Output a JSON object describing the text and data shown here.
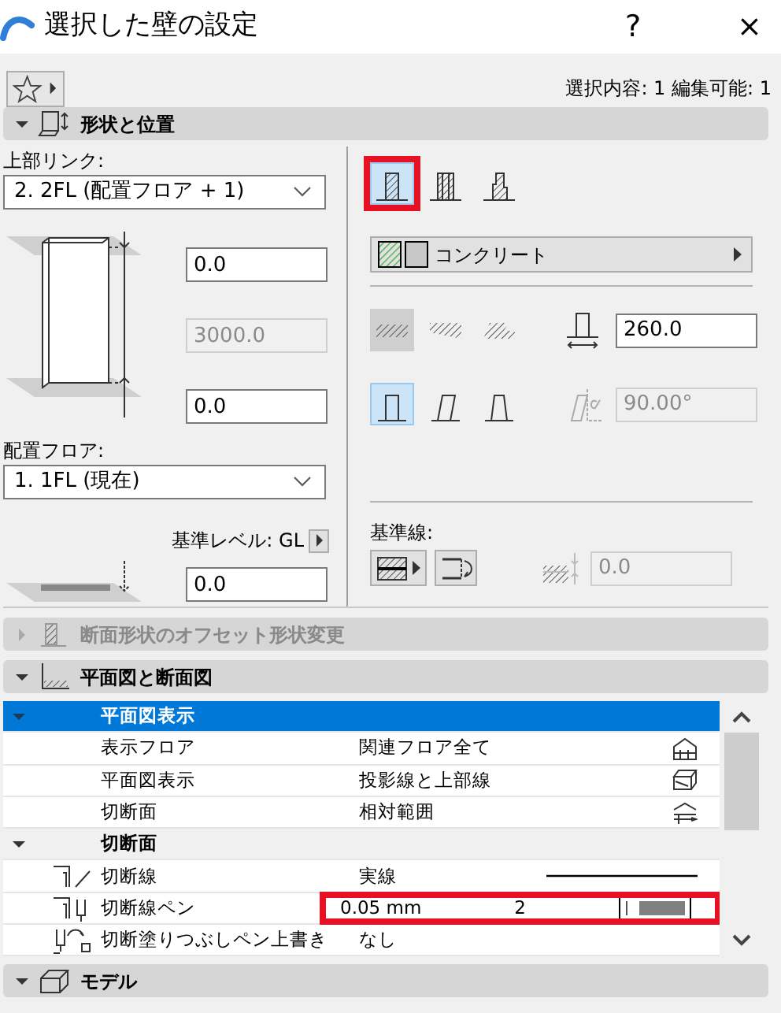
{
  "window": {
    "title": "選択した壁の設定",
    "help": "?",
    "close": "×"
  },
  "toolbar": {
    "selection_info": "選択内容: 1 編集可能: 1"
  },
  "sections": [
    {
      "kind": "geometry",
      "title": "形状と位置",
      "expanded": true,
      "disabled": false
    },
    {
      "kind": "offset",
      "title": "断面形状のオフセット形状変更",
      "expanded": false,
      "disabled": true
    },
    {
      "kind": "plan",
      "title": "平面図と断面図",
      "expanded": true,
      "disabled": false
    },
    {
      "kind": "model",
      "title": "モデル",
      "expanded": true,
      "disabled": false
    }
  ],
  "geometry": {
    "top_link": {
      "label": "上部リンク:",
      "value": "2. 2FL (配置フロア + 1)"
    },
    "top_offset": {
      "value": "0.0",
      "disabled": false
    },
    "height": {
      "value": "3000.0",
      "disabled": true
    },
    "bottom_offset": {
      "value": "0.0",
      "disabled": false
    },
    "home_floor": {
      "label": "配置フロア:",
      "value": "1. 1FL (現在)"
    },
    "ref_level": {
      "label": "基準レベル: GL"
    },
    "ref_offset": {
      "value": "0.0",
      "disabled": false
    },
    "structure_types": [
      {
        "selected": true,
        "highlighted": true
      },
      {
        "selected": false,
        "highlighted": false
      },
      {
        "selected": false,
        "highlighted": false
      }
    ],
    "material": "コンクリート",
    "wall_shapes": [
      {
        "selected": true,
        "disabled": true
      },
      {
        "selected": false,
        "disabled": true
      },
      {
        "selected": false,
        "disabled": true
      }
    ],
    "thickness": {
      "value": "260.0",
      "disabled": false
    },
    "profiles": [
      {
        "selected": true
      },
      {
        "selected": false
      },
      {
        "selected": false
      }
    ],
    "angle": {
      "value": "90.00°",
      "disabled": true
    },
    "reference_line": {
      "label": "基準線:"
    },
    "ref_line_offset": {
      "value": "0.0",
      "disabled": true
    }
  },
  "settings_tree": {
    "groups": [
      {
        "title": "平面図表示",
        "expanded": true,
        "selected": true,
        "rows": [
          {
            "kind": "show-floor",
            "label": "表示フロア",
            "value": "関連フロア全て"
          },
          {
            "kind": "plan-display",
            "label": "平面図表示",
            "value": "投影線と上部線"
          },
          {
            "kind": "cut-plane",
            "label": "切断面",
            "value": "相対範囲"
          }
        ]
      },
      {
        "title": "切断面",
        "expanded": true,
        "selected": false,
        "rows": [
          {
            "kind": "cut-line",
            "label": "切断線",
            "value": "実線"
          },
          {
            "kind": "cut-pen",
            "label": "切断線ペン",
            "value": "0.05 mm",
            "pen_number": "2",
            "highlighted": true
          },
          {
            "kind": "cut-fill",
            "label": "切断塗りつぶしペン上書き",
            "value": "なし"
          }
        ]
      }
    ]
  }
}
